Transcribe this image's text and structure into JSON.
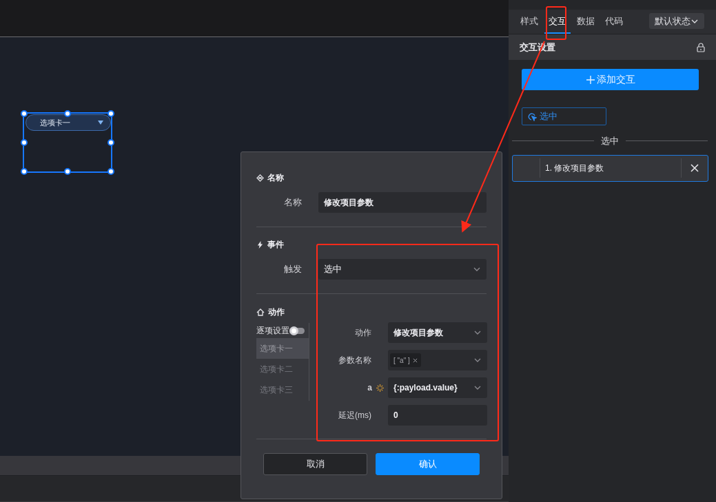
{
  "canvas": {
    "widget": {
      "label": "选项卡一",
      "selected": true
    }
  },
  "panel": {
    "tabs": [
      {
        "label": "样式",
        "selected": false
      },
      {
        "label": "交互",
        "selected": true
      },
      {
        "label": "数据",
        "selected": false
      },
      {
        "label": "代码",
        "selected": false
      }
    ],
    "state_select": "默认状态",
    "section_title": "交互设置",
    "add_button": "添加交互",
    "event_chip": "选中",
    "group_heading": "选中",
    "interactions": [
      {
        "label": "1. 修改项目参数",
        "selected": true
      }
    ]
  },
  "dialog": {
    "name_section": {
      "heading": "名称",
      "label": "名称",
      "value": "修改项目参数"
    },
    "event_section": {
      "heading": "事件",
      "label": "触发",
      "value": "选中"
    },
    "action_section": {
      "heading": "动作",
      "toggle": {
        "label": "逐项设置",
        "on": false
      },
      "items": [
        {
          "label": "选项卡一",
          "selected": true
        },
        {
          "label": "选项卡二",
          "selected": false
        },
        {
          "label": "选项卡三",
          "selected": false
        }
      ],
      "fields": [
        {
          "kind": "select",
          "label": "动作",
          "value": "修改项目参数"
        },
        {
          "kind": "tags",
          "label": "参数名称",
          "tags": [
            "[ \"a\" ]"
          ]
        },
        {
          "kind": "expression",
          "label": "a",
          "value": "{:payload.value}"
        },
        {
          "kind": "input",
          "label": "延迟(ms)",
          "value": "0"
        }
      ]
    },
    "buttons": [
      {
        "label": "取消",
        "kind": "secondary"
      },
      {
        "label": "确认",
        "kind": "primary"
      }
    ]
  }
}
